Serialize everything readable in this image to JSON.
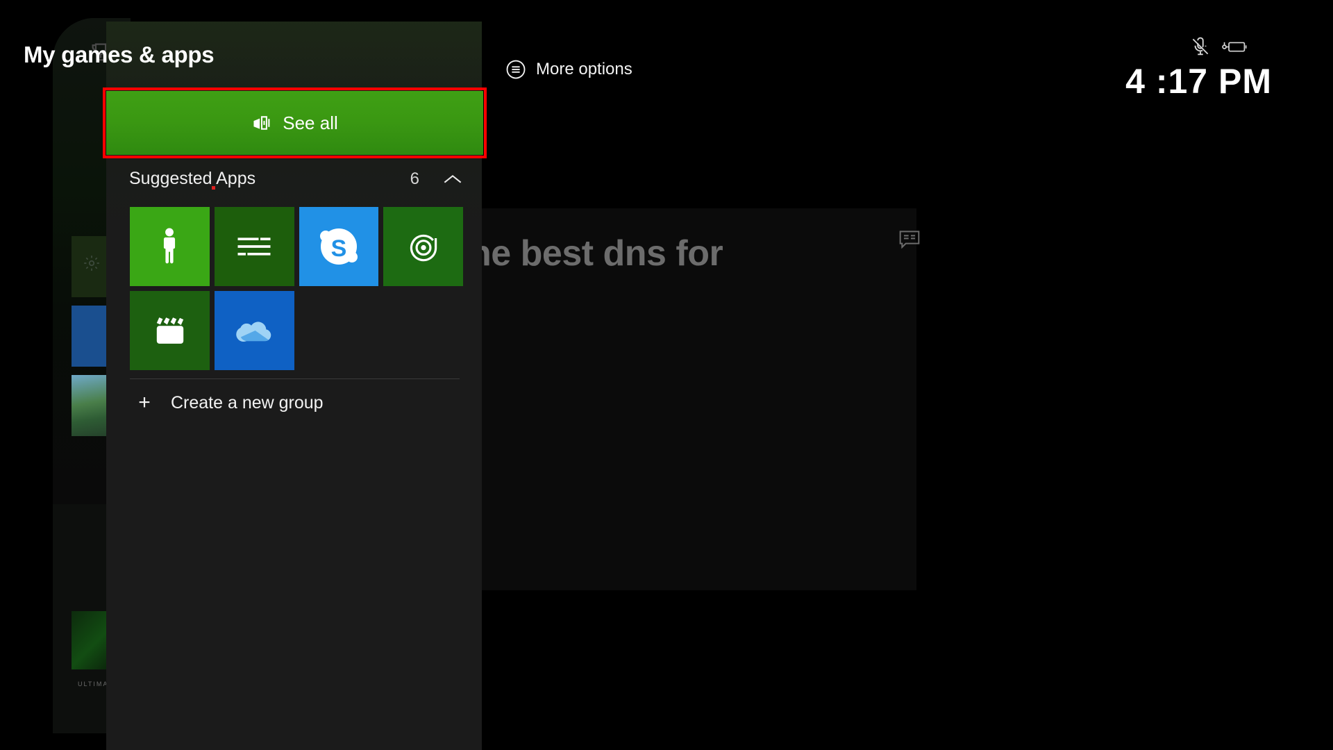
{
  "window": {
    "background_color": "#000000",
    "panel_color": "#1b1b1b"
  },
  "top_bar": {
    "more_options_label": "More options",
    "more_options_icon": "hamburger-circle-icon",
    "status": {
      "mic_muted_icon": "microphone-muted-icon",
      "controller_battery_icon": "controller-battery-icon"
    },
    "clock": "4 :17 PM"
  },
  "background": {
    "article_title": "ts the best dns for\nast",
    "article_badge_icon": "closed-caption-icon",
    "rail_trophy_icon": "trophy-icon",
    "rail_gear_icon": "gear-icon",
    "game_pass_label": "ULTIMATE"
  },
  "flyout": {
    "title": "My games & apps",
    "see_all": {
      "label": "See all",
      "icon": "see-all-icon",
      "background_color": "#3a9712",
      "highlight_color": "#ff0000",
      "highlighted": true
    },
    "group": {
      "title": "Suggested Apps",
      "count": "6",
      "collapse_icon": "chevron-up-icon",
      "expanded": true
    },
    "tiles": [
      {
        "name": "Xbox Avatars",
        "icon": "avatar-person-icon",
        "color": "#3aa715"
      },
      {
        "name": "Xbox Insider Hub",
        "icon": "lines-list-icon",
        "color": "#1d5e0c"
      },
      {
        "name": "Skype",
        "icon": "skype-icon",
        "color": "#2191e6"
      },
      {
        "name": "Groove Music",
        "icon": "groove-music-icon",
        "color": "#1d6b12"
      },
      {
        "name": "Movies & TV",
        "icon": "clapperboard-icon",
        "color": "#1d6010"
      },
      {
        "name": "OneDrive",
        "icon": "onedrive-cloud-icon",
        "color": "#0f61c4"
      }
    ],
    "create_group": {
      "label": "Create a new group",
      "icon": "plus-icon"
    }
  }
}
